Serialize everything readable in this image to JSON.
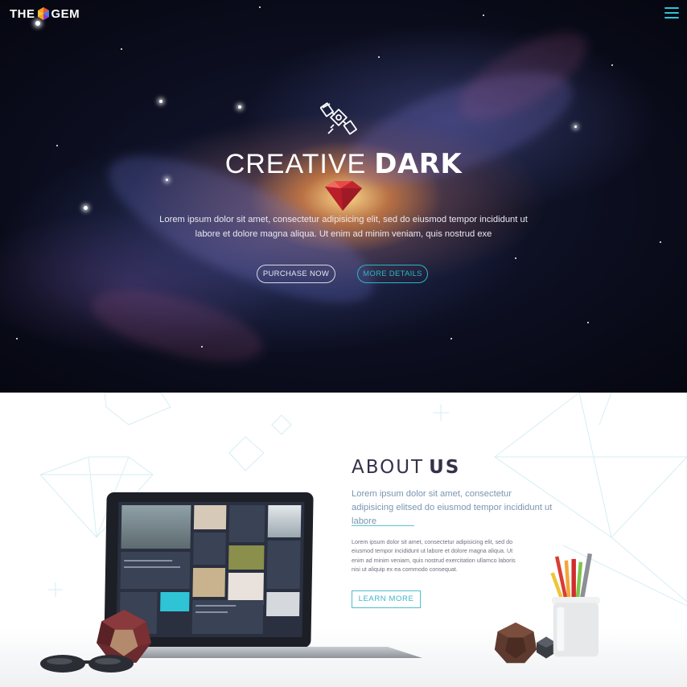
{
  "brand": {
    "logo_left": "THE",
    "logo_right": "GEM"
  },
  "header": {
    "menu_icon": "hamburger-menu-icon"
  },
  "hero": {
    "icon": "satellite-icon",
    "title_light": "CREATIVE",
    "title_bold": "DARK",
    "gem_icon": "red-gem-icon",
    "text": "Lorem ipsum dolor sit amet, consectetur adipisicing elit, sed do eiusmod tempor incididunt ut labore et dolore magna aliqua. Ut enim ad minim veniam, quis nostrud exe",
    "primary_button": "PURCHASE NOW",
    "secondary_button": "MORE DETAILS"
  },
  "about": {
    "title_light": "ABOUT",
    "title_bold": "US",
    "subtitle": "Lorem ipsum dolor sit amet, consectetur adipisicing elitsed do eiusmod tempor incididunt ut labore",
    "body": "Lorem ipsum dolor sit amet, consectetur adipisicing elit, sed do eiusmod tempor incididunt ut labore et dolore magna aliqua. Ut enim ad minim veniam, quis nostrud exercitation ullamco laboris nisi ut aliquip ex ea commodo consequat.",
    "button": "LEARN MORE"
  },
  "colors": {
    "accent": "#2fc3d6",
    "hero_bg": "#0b0d1e",
    "heading": "#34324a",
    "subtitle": "#7a96b0"
  }
}
